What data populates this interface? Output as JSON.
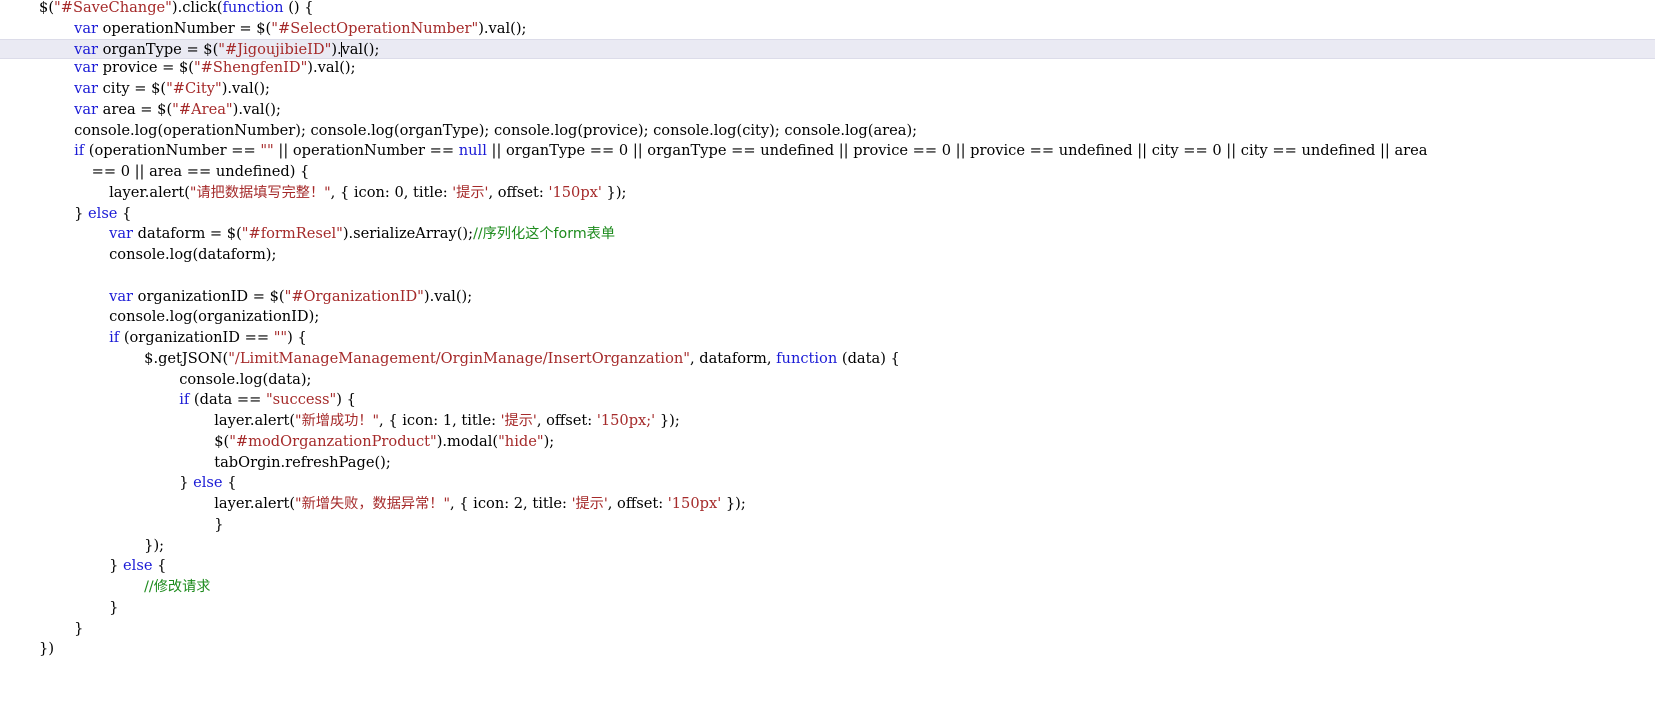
{
  "editor": {
    "language": "javascript",
    "font_size_px": 14.6,
    "line_height_px": 20.75,
    "current_line_index": 2,
    "caret": {
      "line_index": 2,
      "after_text": "var organType = $(\"#JigoujibieID\")."
    },
    "colors": {
      "background": "#ffffff",
      "foreground": "#000000",
      "keyword": "#1b1bd6",
      "string": "#a52a2a",
      "comment": "#1d8b1d",
      "current_line_bg": "#eaeaf3",
      "current_line_border": "#dcdce9",
      "caret": "#000000"
    },
    "lines": [
      {
        "indent": 4,
        "tokens": [
          {
            "t": "$(",
            "c": "pun"
          },
          {
            "t": "\"#SaveChange\"",
            "c": "str"
          },
          {
            "t": ").click(",
            "c": "pun"
          },
          {
            "t": "function",
            "c": "kw"
          },
          {
            "t": " () {",
            "c": "pun"
          }
        ]
      },
      {
        "indent": 8,
        "tokens": [
          {
            "t": "var",
            "c": "kw"
          },
          {
            "t": " operationNumber = $(",
            "c": "plain"
          },
          {
            "t": "\"#SelectOperationNumber\"",
            "c": "str"
          },
          {
            "t": ").val();",
            "c": "plain"
          }
        ]
      },
      {
        "indent": 8,
        "current": true,
        "tokens": [
          {
            "t": "var",
            "c": "kw"
          },
          {
            "t": " organType = $(",
            "c": "plain"
          },
          {
            "t": "\"#JigoujibieID\"",
            "c": "str"
          },
          {
            "t": ").",
            "c": "plain"
          },
          {
            "t": "",
            "c": "caret"
          },
          {
            "t": "val();",
            "c": "plain"
          }
        ]
      },
      {
        "indent": 8,
        "tokens": [
          {
            "t": "var",
            "c": "kw"
          },
          {
            "t": " provice = $(",
            "c": "plain"
          },
          {
            "t": "\"#ShengfenID\"",
            "c": "str"
          },
          {
            "t": ").val();",
            "c": "plain"
          }
        ]
      },
      {
        "indent": 8,
        "tokens": [
          {
            "t": "var",
            "c": "kw"
          },
          {
            "t": " city = $(",
            "c": "plain"
          },
          {
            "t": "\"#City\"",
            "c": "str"
          },
          {
            "t": ").val();",
            "c": "plain"
          }
        ]
      },
      {
        "indent": 8,
        "tokens": [
          {
            "t": "var",
            "c": "kw"
          },
          {
            "t": " area = $(",
            "c": "plain"
          },
          {
            "t": "\"#Area\"",
            "c": "str"
          },
          {
            "t": ").val();",
            "c": "plain"
          }
        ]
      },
      {
        "indent": 8,
        "tokens": [
          {
            "t": "console.log(operationNumber); console.log(organType); console.log(provice); console.log(city); console.log(area);",
            "c": "plain"
          }
        ]
      },
      {
        "indent": 8,
        "tokens": [
          {
            "t": "if",
            "c": "kw"
          },
          {
            "t": " (operationNumber == ",
            "c": "plain"
          },
          {
            "t": "\"\"",
            "c": "str"
          },
          {
            "t": " || operationNumber == ",
            "c": "plain"
          },
          {
            "t": "null",
            "c": "kw"
          },
          {
            "t": " || organType == 0 || organType == undefined || provice == 0 || provice == undefined || city == 0 || city == undefined || area",
            "c": "plain"
          }
        ]
      },
      {
        "indent": 10,
        "tokens": [
          {
            "t": "== 0 || area == undefined) {",
            "c": "plain"
          }
        ]
      },
      {
        "indent": 12,
        "tokens": [
          {
            "t": "layer.alert(",
            "c": "plain"
          },
          {
            "t": "\"请把数据填写完整！\"",
            "c": "str",
            "cjk": true
          },
          {
            "t": ", { icon: 0, title: ",
            "c": "plain"
          },
          {
            "t": "'提示'",
            "c": "str",
            "cjk": true
          },
          {
            "t": ", offset: ",
            "c": "plain"
          },
          {
            "t": "'150px'",
            "c": "str"
          },
          {
            "t": " });",
            "c": "plain"
          }
        ]
      },
      {
        "indent": 8,
        "tokens": [
          {
            "t": "} ",
            "c": "plain"
          },
          {
            "t": "else",
            "c": "kw"
          },
          {
            "t": " {",
            "c": "plain"
          }
        ]
      },
      {
        "indent": 12,
        "tokens": [
          {
            "t": "var",
            "c": "kw"
          },
          {
            "t": " dataform = $(",
            "c": "plain"
          },
          {
            "t": "\"#formResel\"",
            "c": "str"
          },
          {
            "t": ").serializeArray();",
            "c": "plain"
          },
          {
            "t": "//序列化这个form表单",
            "c": "cmt",
            "cjk": true
          }
        ]
      },
      {
        "indent": 12,
        "tokens": [
          {
            "t": "console.log(dataform);",
            "c": "plain"
          }
        ]
      },
      {
        "indent": 0,
        "tokens": []
      },
      {
        "indent": 12,
        "tokens": [
          {
            "t": "var",
            "c": "kw"
          },
          {
            "t": " organizationID = $(",
            "c": "plain"
          },
          {
            "t": "\"#OrganizationID\"",
            "c": "str"
          },
          {
            "t": ").val();",
            "c": "plain"
          }
        ]
      },
      {
        "indent": 12,
        "tokens": [
          {
            "t": "console.log(organizationID);",
            "c": "plain"
          }
        ]
      },
      {
        "indent": 12,
        "tokens": [
          {
            "t": "if",
            "c": "kw"
          },
          {
            "t": " (organizationID == ",
            "c": "plain"
          },
          {
            "t": "\"\"",
            "c": "str"
          },
          {
            "t": ") {",
            "c": "plain"
          }
        ]
      },
      {
        "indent": 16,
        "tokens": [
          {
            "t": "$.getJSON(",
            "c": "plain"
          },
          {
            "t": "\"/LimitManageManagement/OrginManage/InsertOrganzation\"",
            "c": "str"
          },
          {
            "t": ", dataform, ",
            "c": "plain"
          },
          {
            "t": "function",
            "c": "kw"
          },
          {
            "t": " (data) {",
            "c": "plain"
          }
        ]
      },
      {
        "indent": 20,
        "tokens": [
          {
            "t": "console.log(data);",
            "c": "plain"
          }
        ]
      },
      {
        "indent": 20,
        "tokens": [
          {
            "t": "if",
            "c": "kw"
          },
          {
            "t": " (data == ",
            "c": "plain"
          },
          {
            "t": "\"success\"",
            "c": "str"
          },
          {
            "t": ") {",
            "c": "plain"
          }
        ]
      },
      {
        "indent": 24,
        "tokens": [
          {
            "t": "layer.alert(",
            "c": "plain"
          },
          {
            "t": "\"新增成功！\"",
            "c": "str",
            "cjk": true
          },
          {
            "t": ", { icon: 1, title: ",
            "c": "plain"
          },
          {
            "t": "'提示'",
            "c": "str",
            "cjk": true
          },
          {
            "t": ", offset: ",
            "c": "plain"
          },
          {
            "t": "'150px;'",
            "c": "str"
          },
          {
            "t": " });",
            "c": "plain"
          }
        ]
      },
      {
        "indent": 24,
        "tokens": [
          {
            "t": "$(",
            "c": "plain"
          },
          {
            "t": "\"#modOrganzationProduct\"",
            "c": "str"
          },
          {
            "t": ").modal(",
            "c": "plain"
          },
          {
            "t": "\"hide\"",
            "c": "str"
          },
          {
            "t": ");",
            "c": "plain"
          }
        ]
      },
      {
        "indent": 24,
        "tokens": [
          {
            "t": "tabOrgin.refreshPage();",
            "c": "plain"
          }
        ]
      },
      {
        "indent": 20,
        "tokens": [
          {
            "t": "} ",
            "c": "plain"
          },
          {
            "t": "else",
            "c": "kw"
          },
          {
            "t": " {",
            "c": "plain"
          }
        ]
      },
      {
        "indent": 24,
        "tokens": [
          {
            "t": "layer.alert(",
            "c": "plain"
          },
          {
            "t": "\"新增失败，数据异常！\"",
            "c": "str",
            "cjk": true
          },
          {
            "t": ", { icon: 2, title: ",
            "c": "plain"
          },
          {
            "t": "'提示'",
            "c": "str",
            "cjk": true
          },
          {
            "t": ", offset: ",
            "c": "plain"
          },
          {
            "t": "'150px'",
            "c": "str"
          },
          {
            "t": " });",
            "c": "plain"
          }
        ]
      },
      {
        "indent": 24,
        "tokens": [
          {
            "t": "}",
            "c": "plain"
          }
        ]
      },
      {
        "indent": 16,
        "tokens": [
          {
            "t": "});",
            "c": "plain"
          }
        ]
      },
      {
        "indent": 12,
        "tokens": [
          {
            "t": "} ",
            "c": "plain"
          },
          {
            "t": "else",
            "c": "kw"
          },
          {
            "t": " {",
            "c": "plain"
          }
        ]
      },
      {
        "indent": 16,
        "tokens": [
          {
            "t": "//修改请求",
            "c": "cmt",
            "cjk": true
          }
        ]
      },
      {
        "indent": 12,
        "tokens": [
          {
            "t": "}",
            "c": "plain"
          }
        ]
      },
      {
        "indent": 8,
        "tokens": [
          {
            "t": "}",
            "c": "plain"
          }
        ]
      },
      {
        "indent": 4,
        "tokens": [
          {
            "t": "})",
            "c": "plain"
          }
        ]
      }
    ]
  }
}
